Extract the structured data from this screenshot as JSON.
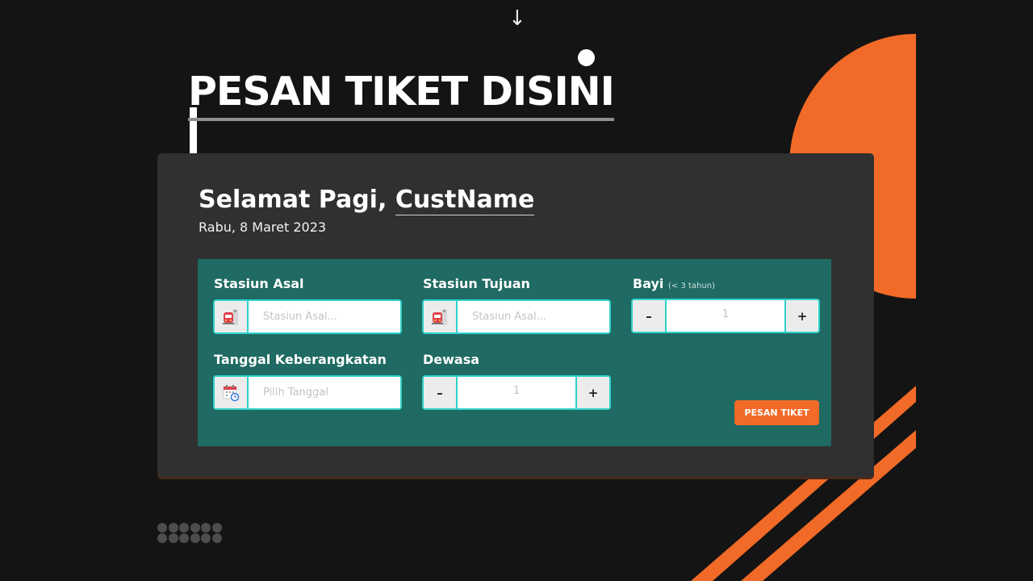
{
  "page": {
    "title": "PESAN TIKET DISINI",
    "arrow_glyph": "↓"
  },
  "greeting": {
    "prefix": "Selamat Pagi,",
    "customer_name": "CustName",
    "date": "Rabu, 8 Maret 2023"
  },
  "form": {
    "origin": {
      "label": "Stasiun Asal",
      "placeholder": "Stasiun Asal...",
      "value": "",
      "icon": "train-icon"
    },
    "destination": {
      "label": "Stasiun Tujuan",
      "placeholder": "Stasiun Asal...",
      "value": "",
      "icon": "train-icon"
    },
    "infant": {
      "label": "Bayi",
      "hint": "(< 3 tahun)",
      "value": "1",
      "minus": "–",
      "plus": "+"
    },
    "departure_date": {
      "label": "Tanggal Keberangkatan",
      "placeholder": "Pilih Tanggal",
      "value": "",
      "icon": "calendar-icon"
    },
    "adult": {
      "label": "Dewasa",
      "value": "1",
      "minus": "–",
      "plus": "+"
    },
    "submit_label": "PESAN TIKET"
  },
  "colors": {
    "background": "#141414",
    "accent": "#f26a27",
    "card": "#303030",
    "panel": "#1f6a63",
    "field_border": "#2fd2c9"
  }
}
